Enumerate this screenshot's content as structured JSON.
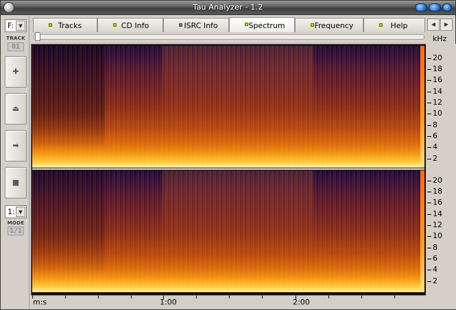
{
  "window": {
    "title": "Tau Analyzer - 1.2"
  },
  "left_panel": {
    "drive_value": "F:",
    "track_caption": "TRACK",
    "track_number": "01",
    "buttons": [
      {
        "name": "add-button",
        "icon": "plus-icon",
        "glyph": "✚"
      },
      {
        "name": "eject-button",
        "icon": "eject-icon",
        "glyph": "⏏"
      },
      {
        "name": "play-button",
        "icon": "play-icon",
        "glyph": "➡"
      },
      {
        "name": "stop-button",
        "icon": "stop-icon",
        "glyph": "■"
      }
    ],
    "mode_value": "1:",
    "mode_caption": "MODE",
    "mode_display": "1/1"
  },
  "tabs": [
    {
      "label": "Tracks",
      "active": false
    },
    {
      "label": "CD Info",
      "active": false
    },
    {
      "label": "ISRC Info",
      "active": false
    },
    {
      "label": "Spectrum",
      "active": true
    },
    {
      "label": "Frequency",
      "active": false
    },
    {
      "label": "Help",
      "active": false
    }
  ],
  "spectrum": {
    "frequency_unit": "kHz",
    "frequency_ticks": [
      "20",
      "18",
      "16",
      "14",
      "12",
      "10",
      "8",
      "6",
      "4",
      "2"
    ],
    "time_unit": "m:s",
    "time_labels": [
      "1:00",
      "2:00"
    ],
    "colors": {
      "low": "#1a0a2e",
      "mid": "#8a2c16",
      "high": "#ffc43a",
      "peak": "#fff0a0"
    }
  }
}
